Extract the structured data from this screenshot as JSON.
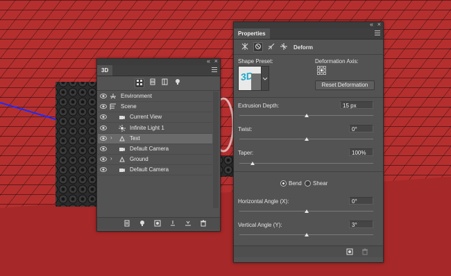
{
  "colors": {
    "canvas_red": "#b52f2f",
    "canvas_dark_red": "#a62828",
    "grid_line": "#1a1a1a",
    "panel_bg": "#535353",
    "selected_row": "#6a6a6a"
  },
  "panel3d": {
    "title": "3D",
    "collapse_glyph": "«",
    "close_glyph": "×",
    "toolbar_icons": [
      "whole-scene-filter-icon",
      "meshes-filter-icon",
      "materials-filter-icon",
      "lights-filter-icon"
    ],
    "rows": [
      {
        "label": "Environment",
        "icon": "environment-icon",
        "caret": false,
        "indent": 0,
        "selected": false
      },
      {
        "label": "Scene",
        "icon": "scene-icon",
        "caret": false,
        "indent": 0,
        "selected": false
      },
      {
        "label": "Current View",
        "icon": "camera-icon",
        "caret": false,
        "indent": 1,
        "selected": false
      },
      {
        "label": "Infinite Light 1",
        "icon": "light-icon",
        "caret": false,
        "indent": 1,
        "selected": false
      },
      {
        "label": "Text",
        "icon": "mesh-icon",
        "caret": true,
        "indent": 1,
        "selected": true
      },
      {
        "label": "Default Camera",
        "icon": "camera-icon",
        "caret": false,
        "indent": 1,
        "selected": false
      },
      {
        "label": "Ground",
        "icon": "mesh-icon",
        "caret": true,
        "indent": 1,
        "selected": false
      },
      {
        "label": "Default Camera",
        "icon": "camera-icon",
        "caret": false,
        "indent": 1,
        "selected": false
      }
    ],
    "bottom_icons": [
      "render-icon",
      "new-light-icon",
      "add-mesh-icon",
      "ground-icon",
      "move-to-ground-icon",
      "trash-icon"
    ]
  },
  "properties": {
    "title": "Properties",
    "collapse_glyph": "«",
    "close_glyph": "×",
    "mode_label": "Deform",
    "mode_icons": [
      "mesh-mode-icon",
      "deform-mode-icon",
      "cap-mode-icon",
      "coordinates-mode-icon"
    ],
    "shape_preset_label": "Shape Preset:",
    "preset_thumb_text": "3D",
    "deformation_axis_label": "Deformation Axis:",
    "reset_deformation_label": "Reset Deformation",
    "extrusion_depth": {
      "label": "Extrusion Depth:",
      "value": "15 px",
      "slider": 0.5
    },
    "twist": {
      "label": "Twist:",
      "value": "0°",
      "slider": 0.5
    },
    "taper": {
      "label": "Taper:",
      "value": "100%",
      "slider": 0.1
    },
    "bend_label": "Bend",
    "shear_label": "Shear",
    "bend_selected": true,
    "horizontal_angle": {
      "label": "Horizontal Angle (X):",
      "value": "0°",
      "slider": 0.5
    },
    "vertical_angle": {
      "label": "Vertical Angle (Y):",
      "value": "3°",
      "slider": 0.5
    },
    "bottom_icons": [
      "render-settings-icon",
      "delete-icon"
    ]
  }
}
